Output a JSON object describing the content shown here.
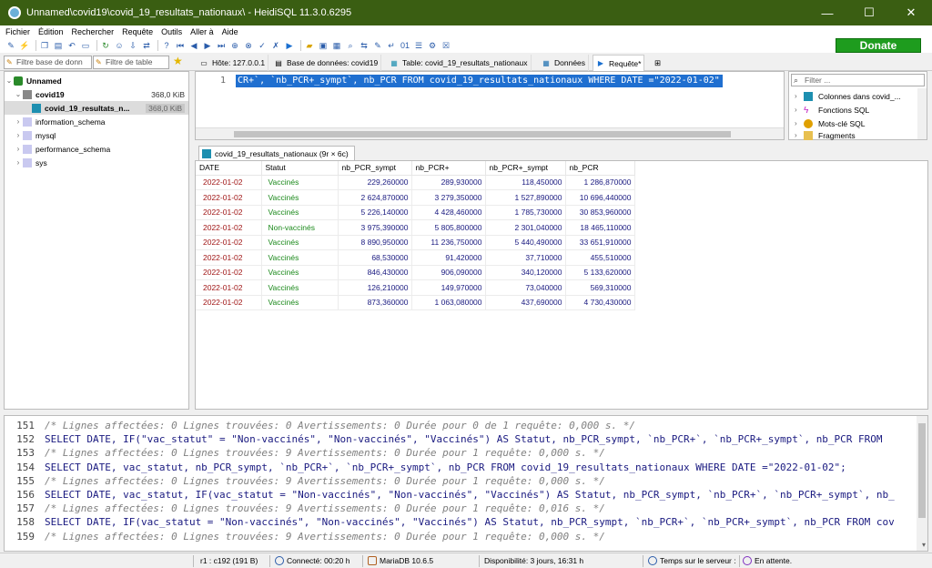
{
  "window": {
    "title": "Unnamed\\covid19\\covid_19_resultats_nationaux\\ - HeidiSQL 11.3.0.6295",
    "minimize": "—",
    "maximize": "☐",
    "close": "✕"
  },
  "menu": [
    "Fichier",
    "Édition",
    "Rechercher",
    "Requête",
    "Outils",
    "Aller à",
    "Aide"
  ],
  "toolbar": {
    "donate_label": "Donate"
  },
  "filters": {
    "db_placeholder": "Filtre base de donn",
    "table_placeholder": "Filtre de table"
  },
  "tabs": [
    {
      "label": "Hôte: 127.0.0.1",
      "icon": "host-icon"
    },
    {
      "label": "Base de données: covid19",
      "icon": "database-icon"
    },
    {
      "label": "Table: covid_19_resultats_nationaux",
      "icon": "table-icon"
    },
    {
      "label": "Données",
      "icon": "grid-icon"
    },
    {
      "label": "Requête*",
      "icon": "play-icon"
    }
  ],
  "tree": {
    "session": "Unnamed",
    "db": {
      "name": "covid19",
      "size": "368,0 KiB"
    },
    "table": {
      "name": "covid_19_resultats_n...",
      "size": "368,0 KiB"
    },
    "others": [
      "information_schema",
      "mysql",
      "performance_schema",
      "sys"
    ]
  },
  "editor": {
    "line_number": "1",
    "code": "CR+`, `nb_PCR+_sympt`, nb_PCR FROM covid_19_resultats_nationaux WHERE DATE =\"2022-01-02\""
  },
  "helper": {
    "filter_placeholder": "Filter ...",
    "items": [
      "Colonnes dans covid_...",
      "Fonctions SQL",
      "Mots-clé SQL",
      "Fragments"
    ]
  },
  "result": {
    "tab_label": "covid_19_resultats_nationaux (9r × 6c)",
    "columns": [
      "DATE",
      "Statut",
      "nb_PCR_sympt",
      "nb_PCR+",
      "nb_PCR+_sympt",
      "nb_PCR"
    ],
    "rows": [
      [
        "2022-01-02",
        "Vaccinés",
        "229,260000",
        "289,930000",
        "118,450000",
        "1 286,870000"
      ],
      [
        "2022-01-02",
        "Vaccinés",
        "2 624,870000",
        "3 279,350000",
        "1 527,890000",
        "10 696,440000"
      ],
      [
        "2022-01-02",
        "Vaccinés",
        "5 226,140000",
        "4 428,460000",
        "1 785,730000",
        "30 853,960000"
      ],
      [
        "2022-01-02",
        "Non-vaccinés",
        "3 975,390000",
        "5 805,800000",
        "2 301,040000",
        "18 465,110000"
      ],
      [
        "2022-01-02",
        "Vaccinés",
        "8 890,950000",
        "11 236,750000",
        "5 440,490000",
        "33 651,910000"
      ],
      [
        "2022-01-02",
        "Vaccinés",
        "68,530000",
        "91,420000",
        "37,710000",
        "455,510000"
      ],
      [
        "2022-01-02",
        "Vaccinés",
        "846,430000",
        "906,090000",
        "340,120000",
        "5 133,620000"
      ],
      [
        "2022-01-02",
        "Vaccinés",
        "126,210000",
        "149,970000",
        "73,040000",
        "569,310000"
      ],
      [
        "2022-01-02",
        "Vaccinés",
        "873,360000",
        "1 063,080000",
        "437,690000",
        "4 730,430000"
      ]
    ]
  },
  "log": [
    {
      "n": "151",
      "type": "comment",
      "text": "/* Lignes affectées: 0  Lignes trouvées: 0  Avertissements: 0  Durée pour 0 de 1 requête: 0,000 s. */"
    },
    {
      "n": "152",
      "type": "sql",
      "text": "SELECT DATE, IF(\"vac_statut\" = \"Non-vaccinés\", \"Non-vaccinés\", \"Vaccinés\") AS Statut,  nb_PCR_sympt, `nb_PCR+`, `nb_PCR+_sympt`, nb_PCR FROM"
    },
    {
      "n": "153",
      "type": "comment",
      "text": "/* Lignes affectées: 0  Lignes trouvées: 9  Avertissements: 0  Durée pour 1 requête: 0,000 s. */"
    },
    {
      "n": "154",
      "type": "sql",
      "text": "SELECT DATE, vac_statut,  nb_PCR_sympt, `nb_PCR+`, `nb_PCR+_sympt`, nb_PCR FROM covid_19_resultats_nationaux WHERE DATE =\"2022-01-02\";"
    },
    {
      "n": "155",
      "type": "comment",
      "text": "/* Lignes affectées: 0  Lignes trouvées: 9  Avertissements: 0  Durée pour 1 requête: 0,000 s. */"
    },
    {
      "n": "156",
      "type": "sql",
      "text": "SELECT DATE, vac_statut, IF(vac_statut = \"Non-vaccinés\", \"Non-vaccinés\", \"Vaccinés\") AS Statut, nb_PCR_sympt, `nb_PCR+`, `nb_PCR+_sympt`, nb_"
    },
    {
      "n": "157",
      "type": "comment",
      "text": "/* Lignes affectées: 0  Lignes trouvées: 9  Avertissements: 0  Durée pour 1 requête: 0,016 s. */"
    },
    {
      "n": "158",
      "type": "sql",
      "text": "SELECT DATE, IF(vac_statut = \"Non-vaccinés\", \"Non-vaccinés\", \"Vaccinés\") AS Statut, nb_PCR_sympt, `nb_PCR+`, `nb_PCR+_sympt`, nb_PCR FROM cov"
    },
    {
      "n": "159",
      "type": "comment",
      "text": "/* Lignes affectées: 0  Lignes trouvées: 9  Avertissements: 0  Durée pour 1 requête: 0,000 s. */"
    }
  ],
  "status": {
    "position": "r1 : c192 (191 B)",
    "connected": "Connecté: 00:20 h",
    "server": "MariaDB 10.6.5",
    "uptime": "Disponibilité: 3 jours, 16:31 h",
    "server_time": "Temps sur le serveur :",
    "state": "En attente."
  },
  "colors": {
    "titlebar": "#3a5e12",
    "selection": "#1f6fd0",
    "date_text": "#a01616",
    "status_text": "#1c8a1c",
    "number_text": "#1a1a80",
    "donate": "#1e9c1e"
  }
}
